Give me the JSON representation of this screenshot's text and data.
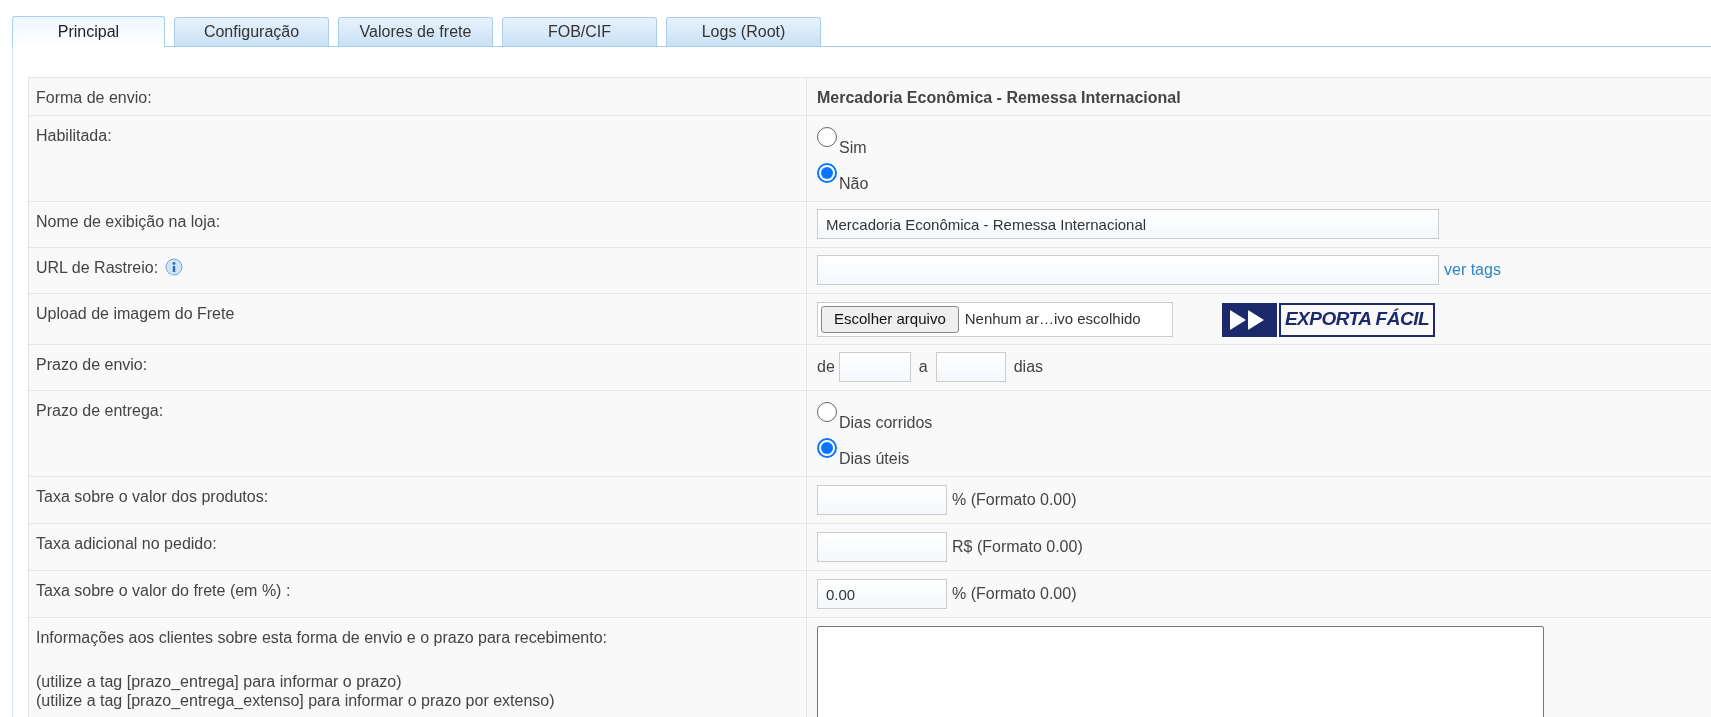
{
  "tabs": [
    {
      "label": "Principal",
      "selected": true
    },
    {
      "label": "Configuração",
      "selected": false
    },
    {
      "label": "Valores de frete",
      "selected": false
    },
    {
      "label": "FOB/CIF",
      "selected": false
    },
    {
      "label": "Logs (Root)",
      "selected": false
    }
  ],
  "rows": [
    {
      "kind": "value",
      "label": "Forma de envio:",
      "value": "Mercadoria Econômica - Remessa Internacional"
    },
    {
      "kind": "radio",
      "label": "Habilitada:",
      "options": [
        {
          "label": "Sim",
          "selected": false
        },
        {
          "label": "Não",
          "selected": true
        }
      ]
    },
    {
      "kind": "text",
      "label": "Nome de exibição na loja:",
      "value": "Mercadoria Econômica - Remessa Internacional"
    },
    {
      "kind": "text",
      "label": "URL de Rastreio:",
      "info": true,
      "link": "ver tags"
    },
    {
      "kind": "file",
      "label": "Upload de imagem do Frete",
      "button": "Escolher arquivo",
      "status": "Nenhum ar…ivo escolhido",
      "logo_text": "EXPORTA FÁCIL"
    },
    {
      "kind": "range",
      "label": "Prazo de envio:",
      "prefix": "de",
      "middle": "a",
      "suffix": "dias"
    },
    {
      "kind": "radio",
      "label": "Prazo de entrega:",
      "options": [
        {
          "label": "Dias corridos",
          "selected": false
        },
        {
          "label": "Dias úteis",
          "selected": true
        }
      ]
    },
    {
      "kind": "number",
      "label": "Taxa sobre o valor dos produtos:",
      "suffix": "% (Formato 0.00)"
    },
    {
      "kind": "number",
      "label": "Taxa adicional no pedido:",
      "suffix": "R$ (Formato 0.00)"
    },
    {
      "kind": "number",
      "label": "Taxa sobre o valor do frete (em %) :",
      "value": "0.00",
      "suffix": "% (Formato 0.00)"
    },
    {
      "kind": "textarea",
      "label": "Informações aos clientes sobre esta forma de envio e o prazo para recebimento:",
      "notes": [
        "(utilize a tag [prazo_entrega] para informar o prazo)",
        "(utilize a tag [prazo_entrega_extenso] para informar o prazo por extenso)"
      ]
    }
  ]
}
